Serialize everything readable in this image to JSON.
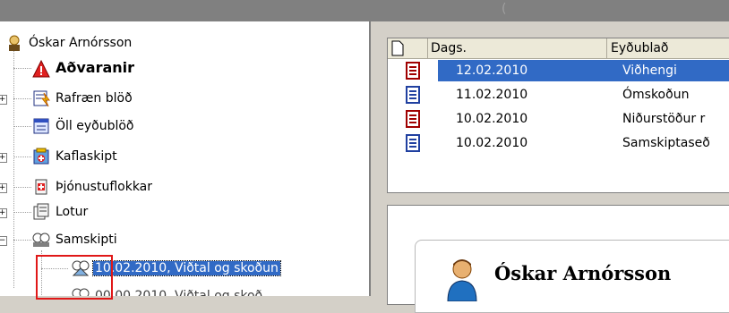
{
  "window": {
    "title_fragment": "("
  },
  "tree": {
    "root": "Óskar Arnórsson",
    "items": [
      {
        "label": "Aðvaranir",
        "icon": "warning-icon"
      },
      {
        "label": "Rafræn blöð",
        "icon": "electronic-forms-icon"
      },
      {
        "label": "Öll eyðublöð",
        "icon": "all-forms-icon"
      },
      {
        "label": "Kaflaskipt",
        "icon": "sections-icon"
      },
      {
        "label": "Þjónustuflokkar",
        "icon": "service-categories-icon"
      },
      {
        "label": "Lotur",
        "icon": "sessions-icon"
      },
      {
        "label": "Samskipti",
        "icon": "communications-icon"
      },
      {
        "label": "10.02.2010, Viðtal og skoðun",
        "icon": "communication-entry-icon"
      },
      {
        "label": "00.00.2010, Viðtal og skoð",
        "icon": "communication-entry-icon"
      }
    ]
  },
  "list": {
    "columns": {
      "date": "Dags.",
      "form": "Eyðublað"
    },
    "rows": [
      {
        "date": "12.02.2010",
        "form": "Viðhengi",
        "icon": "document-red-icon"
      },
      {
        "date": "11.02.2010",
        "form": "Ómskoðun",
        "icon": "document-blue-icon"
      },
      {
        "date": "10.02.2010",
        "form": "Niðurstöður r",
        "icon": "document-red-icon"
      },
      {
        "date": "10.02.2010",
        "form": "Samskiptaseð",
        "icon": "document-blue-icon"
      }
    ]
  },
  "detail": {
    "patient_name": "Óskar Arnórsson"
  },
  "colors": {
    "selection": "#316ac5",
    "focus_box": "#e01818"
  }
}
